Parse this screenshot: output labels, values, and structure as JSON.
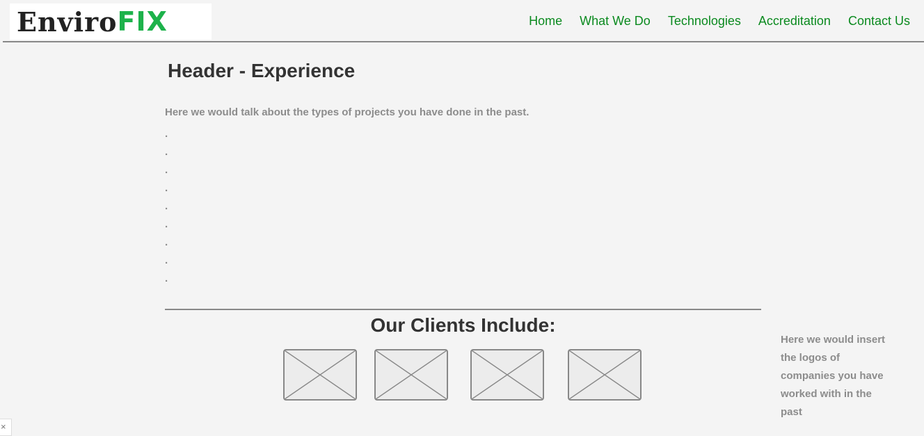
{
  "brand": {
    "logo_part1": "Enviro",
    "logo_part2": "FIX",
    "colors": {
      "dark": "#222222",
      "green": "#1db24b"
    }
  },
  "nav": {
    "items": [
      {
        "label": "Home"
      },
      {
        "label": "What We Do"
      },
      {
        "label": "Technologies"
      },
      {
        "label": "Accreditation"
      },
      {
        "label": "Contact Us"
      }
    ],
    "color": "#0b8a1f"
  },
  "main": {
    "title": "Header - Experience",
    "intro": "Here we would talk about the types of projects you have done in the past.",
    "dots": [
      ".",
      ".",
      ".",
      ".",
      ".",
      ".",
      ".",
      ".",
      "."
    ]
  },
  "clients": {
    "title": "Our Clients Include:",
    "logos": [
      {
        "icon": "image-placeholder-icon"
      },
      {
        "icon": "image-placeholder-icon"
      },
      {
        "icon": "image-placeholder-icon"
      },
      {
        "icon": "image-placeholder-icon"
      }
    ],
    "side_note": "Here we would insert\nthe logos of\ncompanies you have\nworked with  in the\npast"
  },
  "ui": {
    "close_glyph": "×",
    "close_icon": "close-icon"
  }
}
